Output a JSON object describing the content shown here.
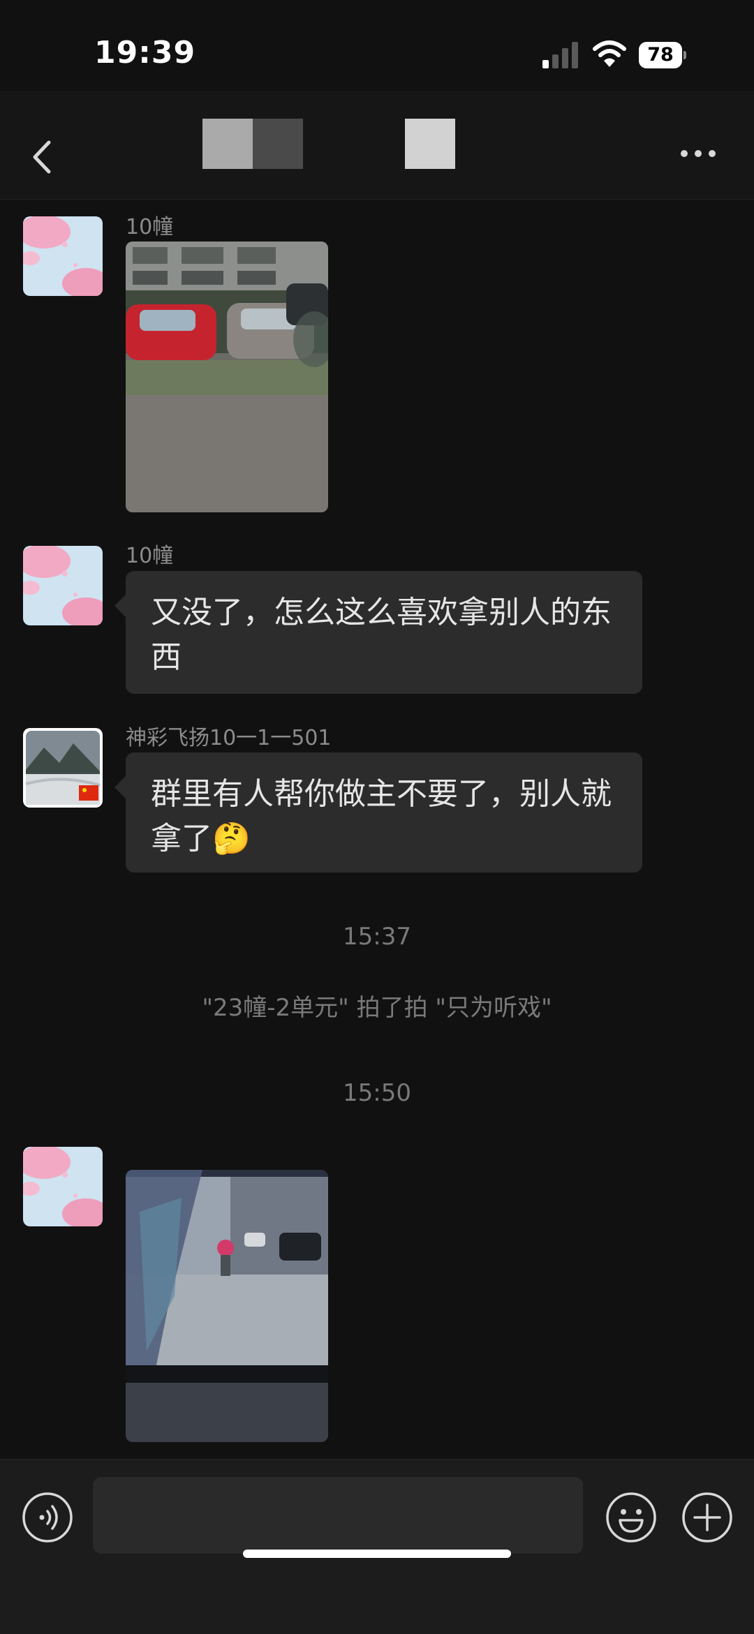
{
  "status_bar": {
    "time": "19:39",
    "battery_level": "78",
    "icons": [
      "signal-icon",
      "wifi-icon",
      "battery-icon"
    ]
  },
  "nav": {
    "back_icon": "chevron-left-icon",
    "more_icon": "ellipsis-icon"
  },
  "messages": [
    {
      "type": "image",
      "sender": "10幢",
      "avatar": "cherry-blossom-avatar",
      "image": "parked-cars-photo"
    },
    {
      "type": "text",
      "sender": "10幢",
      "avatar": "cherry-blossom-avatar",
      "text": "又没了，怎么这么喜欢拿别人的东西"
    },
    {
      "type": "text",
      "sender": "神彩飞扬10一1一501",
      "avatar": "mountain-avatar",
      "text": "群里有人帮你做主不要了，别人就拿了🤔"
    },
    {
      "type": "timestamp",
      "text": "15:37"
    },
    {
      "type": "system",
      "text": "\"23幢-2单元\" 拍了拍 \"只为听戏\""
    },
    {
      "type": "timestamp",
      "text": "15:50"
    },
    {
      "type": "image",
      "avatar": "cherry-blossom-avatar",
      "image": "surveillance-monitor-photo"
    }
  ],
  "input_bar": {
    "placeholder": "",
    "voice_icon": "voice-icon",
    "emoji_icon": "emoji-icon",
    "plus_icon": "plus-icon"
  },
  "colors": {
    "background": "#111111",
    "bubble": "#2c2c2c",
    "meta_text": "#8c8c8c"
  }
}
